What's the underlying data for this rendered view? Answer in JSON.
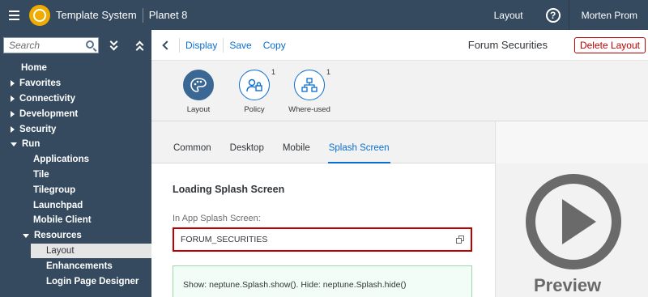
{
  "shell": {
    "app_title": "Template System",
    "system_name": "Planet 8",
    "layout_link": "Layout",
    "help_glyph": "?",
    "user_name": "Morten Prom"
  },
  "sidebar": {
    "search_placeholder": "Search",
    "items": [
      {
        "label": "Home",
        "expander": "none"
      },
      {
        "label": "Favorites",
        "expander": "collapsed"
      },
      {
        "label": "Connectivity",
        "expander": "collapsed"
      },
      {
        "label": "Development",
        "expander": "collapsed"
      },
      {
        "label": "Security",
        "expander": "collapsed"
      },
      {
        "label": "Run",
        "expander": "expanded"
      },
      {
        "label": "Applications",
        "expander": "none"
      },
      {
        "label": "Tile",
        "expander": "none"
      },
      {
        "label": "Tilegroup",
        "expander": "none"
      },
      {
        "label": "Launchpad",
        "expander": "none"
      },
      {
        "label": "Mobile Client",
        "expander": "none"
      },
      {
        "label": "Resources",
        "expander": "expanded"
      },
      {
        "label": "Layout",
        "expander": "none",
        "selected": true
      },
      {
        "label": "Enhancements",
        "expander": "none"
      },
      {
        "label": "Login Page Designer",
        "expander": "none"
      }
    ]
  },
  "toolbar": {
    "display": "Display",
    "save": "Save",
    "copy": "Copy",
    "title": "Forum Securities",
    "delete": "Delete Layout"
  },
  "icon_tabs": [
    {
      "label": "Layout",
      "icon": "palette-icon",
      "badge": ""
    },
    {
      "label": "Policy",
      "icon": "user-lock-icon",
      "badge": "1"
    },
    {
      "label": "Where-used",
      "icon": "hierarchy-icon",
      "badge": "1"
    }
  ],
  "tabs": [
    "Common",
    "Desktop",
    "Mobile",
    "Splash Screen"
  ],
  "active_tab": "Splash Screen",
  "splash": {
    "heading": "Loading Splash Screen",
    "field_label": "In App Splash Screen:",
    "field_value": "FORUM_SECURITIES",
    "message": "Show: neptune.Splash.show(). Hide: neptune.Splash.hide()"
  },
  "preview": {
    "label": "Preview"
  },
  "colors": {
    "shell": "#354a5f",
    "accent": "#0a6ed1",
    "error": "#bb0000",
    "success_bg": "#f1fdf6",
    "logo": "#f0ab00"
  }
}
